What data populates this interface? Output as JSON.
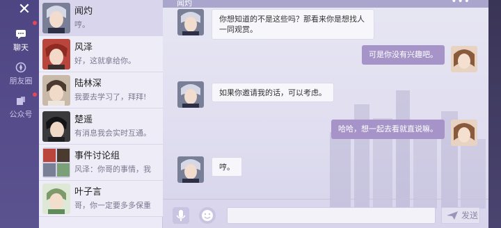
{
  "nav": {
    "close_glyph": "✕",
    "items": [
      {
        "label": "聊天",
        "icon": "chat-icon",
        "active": true,
        "badge": true
      },
      {
        "label": "朋友圈",
        "icon": "moments-icon",
        "active": false,
        "badge": false
      },
      {
        "label": "公众号",
        "icon": "official-account-icon",
        "active": false,
        "badge": true
      }
    ]
  },
  "contacts": [
    {
      "name": "闻灼",
      "preview": "哼。",
      "active": true
    },
    {
      "name": "风泽",
      "preview": "好，这就拿给你。",
      "active": false
    },
    {
      "name": "陆林深",
      "preview": "我要去学习了，拜拜!",
      "active": false
    },
    {
      "name": "楚遥",
      "preview": "有消息我会实时互通。",
      "active": false
    },
    {
      "name": "事件讨论组",
      "preview": "风泽：你哥的事情，我",
      "active": false
    },
    {
      "name": "叶子言",
      "preview": "哥，你一定要多多保重",
      "active": false
    }
  ],
  "chat": {
    "title": "闻灼",
    "more_glyph": "•••",
    "messages": [
      {
        "side": "left",
        "line1": "你想知道的不是这些吗？那看来你是想找人",
        "line2": "一同观赏。"
      },
      {
        "side": "right",
        "line1": "可是你没有兴趣吧。"
      },
      {
        "side": "left",
        "line1": "如果你邀请我的话，可以考虑。"
      },
      {
        "side": "right",
        "line1": "哈哈，想一起去看就直说嘛。"
      },
      {
        "side": "left",
        "line1": "哼。"
      }
    ],
    "input": {
      "placeholder": "",
      "send_label": "发送"
    }
  },
  "colors": {
    "nav_bg": "#574d8c",
    "bubble_right": "#a694c8",
    "badge": "#e6455a"
  }
}
